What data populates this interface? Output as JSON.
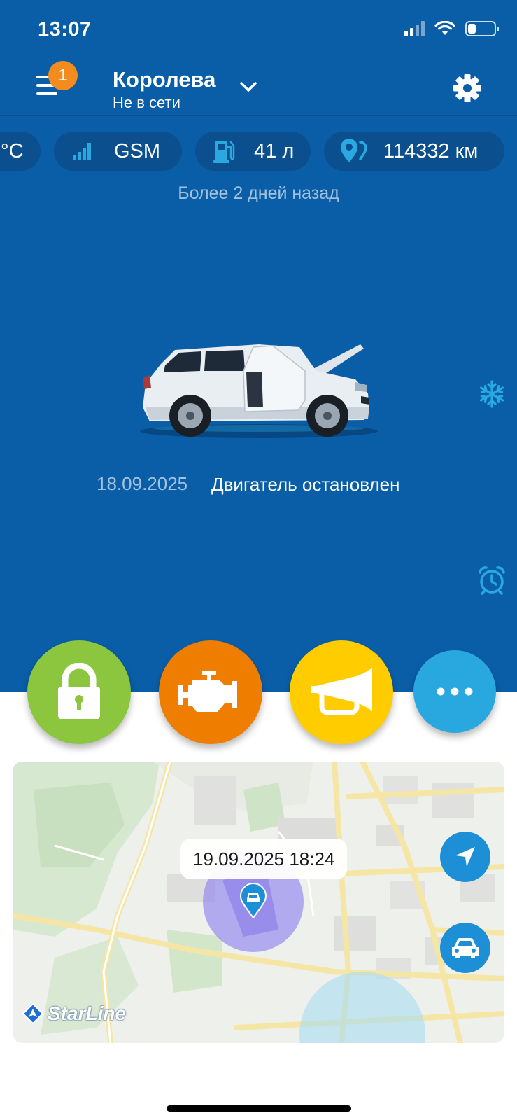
{
  "status_bar": {
    "time": "13:07",
    "signal_icon": "cellular-signal-icon",
    "wifi_icon": "wifi-icon",
    "battery_icon": "battery-icon",
    "battery_level": 0.3
  },
  "header": {
    "menu_icon": "hamburger-menu-icon",
    "notification_count": "1",
    "car_name": "Королева",
    "connection_status": "Не в сети",
    "dropdown_icon": "chevron-down-icon",
    "settings_icon": "gear-icon"
  },
  "indicators": [
    {
      "icon": "thermometer-icon",
      "label": "°C"
    },
    {
      "icon": "signal-strength-icon",
      "label": "GSM"
    },
    {
      "icon": "fuel-pump-icon",
      "label": "41 л"
    },
    {
      "icon": "odometer-pin-icon",
      "label": "114332 км"
    }
  ],
  "last_seen": "Более 2 дней назад",
  "car": {
    "image": "car-suv-doors-open-image",
    "date": "18.09.2025",
    "engine_status": "Двигатель остановлен"
  },
  "side_icons": {
    "climate": "snowflake-icon",
    "alarm": "alarm-clock-icon"
  },
  "actions": [
    {
      "name": "lock",
      "icon": "lock-icon",
      "color": "#8cc63f"
    },
    {
      "name": "engine-start",
      "icon": "engine-icon",
      "color": "#ef7d00"
    },
    {
      "name": "horn",
      "icon": "horn-icon",
      "color": "#ffcc00"
    },
    {
      "name": "more",
      "icon": "more-dots-icon",
      "color": "#29a8e0"
    }
  ],
  "map": {
    "position_time": "19.09.2025 18:24",
    "locate_icon": "navigation-arrow-icon",
    "car_icon": "car-icon",
    "marker_icon": "car-location-marker-icon",
    "brand": "StarLine",
    "brand_icon": "starline-logo-icon"
  },
  "colors": {
    "primary_blue": "#0a5ea8",
    "chip_bg": "#0b4f8e",
    "accent_cyan": "#2aa8e0",
    "badge_orange": "#f28c1e"
  }
}
